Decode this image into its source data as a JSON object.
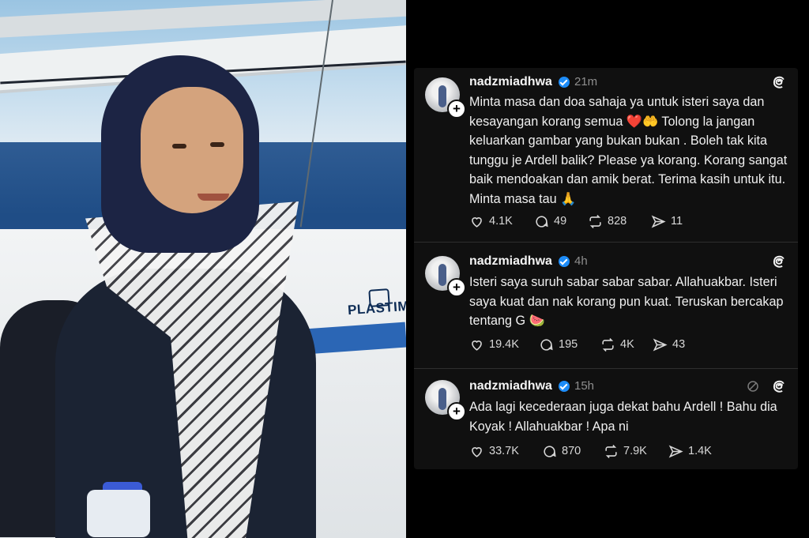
{
  "posts": [
    {
      "username": "nadzmiadhwa",
      "time": "21m",
      "text": "Minta masa dan doa sahaja ya untuk isteri saya dan kesayangan korang semua ❤️🤲 Tolong la jangan keluarkan gambar yang bukan bukan . Boleh tak kita tunggu je Ardell balik? Please ya korang. Korang sangat baik mendoakan dan amik berat. Terima kasih untuk itu. Minta masa tau 🙏",
      "likes": "4.1K",
      "replies": "49",
      "reposts": "828",
      "shares": "11"
    },
    {
      "username": "nadzmiadhwa",
      "time": "4h",
      "text": "Isteri saya suruh sabar sabar sabar. Allahuakbar. Isteri saya kuat dan nak korang pun kuat. Teruskan bercakap tentang G 🍉",
      "likes": "19.4K",
      "replies": "195",
      "reposts": "4K",
      "shares": "43"
    },
    {
      "username": "nadzmiadhwa",
      "time": "15h",
      "text": "Ada lagi kecederaan juga dekat bahu Ardell ! Bahu dia Koyak ! Allahuakbar ! Apa ni",
      "likes": "33.7K",
      "replies": "870",
      "reposts": "7.9K",
      "shares": "1.4K"
    }
  ],
  "photo": {
    "boat_brand": "PLASTIMO"
  },
  "icons": {
    "post_header": "threads-icon",
    "avatar_badge": "follow-plus-icon",
    "like": "heart-icon",
    "reply": "comment-icon",
    "repost": "repost-icon",
    "share": "share-icon",
    "muted": "muted-icon"
  },
  "colors": {
    "background": "#101010",
    "verified": "#1d8cf8"
  }
}
